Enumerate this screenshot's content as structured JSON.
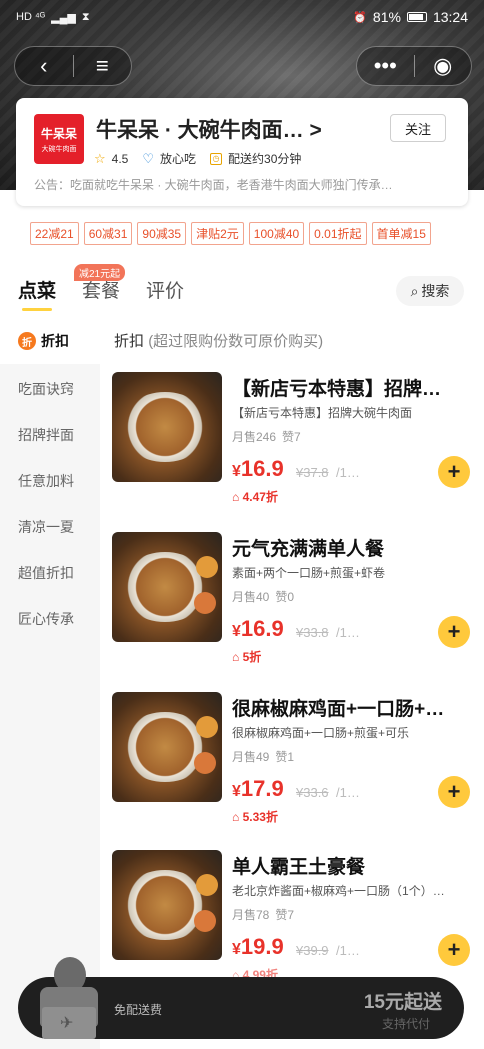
{
  "status_bar": {
    "left_icons": "HD ⁴ᴳ",
    "battery": "81%",
    "time": "13:24"
  },
  "shop": {
    "logo_text": "牛呆呆",
    "logo_sub": "大碗牛肉面",
    "name": "牛呆呆 · 大碗牛肉面… >",
    "follow_label": "关注",
    "rating": "4.5",
    "trust": "放心吃",
    "delivery": "配送约30分钟",
    "notice": "公告：吃面就吃牛呆呆 · 大碗牛肉面，老香港牛肉面大师独门传承…"
  },
  "coupons": [
    "22减21",
    "60减31",
    "90减35",
    "津贴2元",
    "100减40",
    "0.01折起",
    "首单减15"
  ],
  "tabs": {
    "order": "点菜",
    "combo": "套餐",
    "review": "评价",
    "combo_badge": "减21元起",
    "search": "搜索"
  },
  "sidebar": {
    "discount_icon": "折",
    "items": [
      "折扣",
      "吃面诀窍",
      "招牌拌面",
      "任意加料",
      "清凉一夏",
      "超值折扣",
      "匠心传承"
    ]
  },
  "section": {
    "title": "折扣",
    "subtitle": "(超过限购份数可原价购买)"
  },
  "items": [
    {
      "name": "【新店亏本特惠】招牌…",
      "desc": "【新店亏本特惠】招牌大碗牛肉面",
      "sold": "月售246",
      "likes": "赞7",
      "price": "16.9",
      "orig": "¥37.8",
      "limit": "/1…",
      "discount": "4.47折"
    },
    {
      "name": "元气充满满单人餐",
      "desc": "素面+两个一口肠+煎蛋+虾卷",
      "sold": "月售40",
      "likes": "赞0",
      "price": "16.9",
      "orig": "¥33.8",
      "limit": "/1…",
      "discount": "5折"
    },
    {
      "name": "很麻椒麻鸡面+一口肠+…",
      "desc": "很麻椒麻鸡面+一口肠+煎蛋+可乐",
      "sold": "月售49",
      "likes": "赞1",
      "price": "17.9",
      "orig": "¥33.6",
      "limit": "/1…",
      "discount": "5.33折"
    },
    {
      "name": "单人霸王土豪餐",
      "desc": "老北京炸酱面+椒麻鸡+一口肠（1个）…",
      "sold": "月售78",
      "likes": "赞7",
      "price": "19.9",
      "orig": "¥39.9",
      "limit": "/1…",
      "discount": "4.99折"
    }
  ],
  "cart": {
    "free_delivery": "免配送费",
    "min_order": "15元起送",
    "pay_by": "支持代付"
  },
  "colors": {
    "accent_yellow": "#ffc93c",
    "price_red": "#e8322a",
    "coupon_border": "#f2a48e"
  }
}
